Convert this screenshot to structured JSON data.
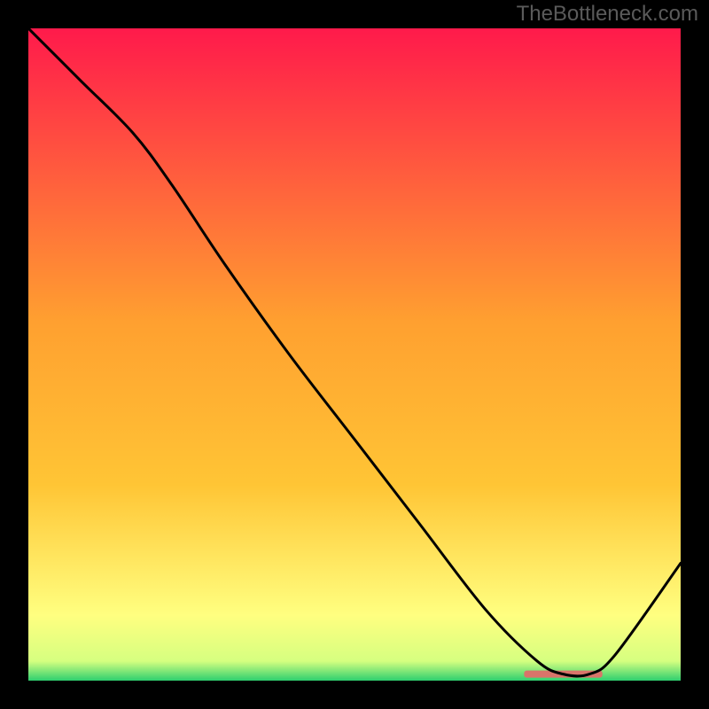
{
  "watermark": "TheBottleneck.com",
  "colors": {
    "bg": "#000000",
    "line": "#000000",
    "marker": "#d9746a",
    "watermark": "#5a5a5a",
    "gradient_top": "#ff1a4b",
    "gradient_mid": "#ffc535",
    "gradient_low": "#ffff80",
    "gradient_bottom": "#2ecf6f"
  },
  "chart_data": {
    "type": "line",
    "title": "",
    "xlabel": "",
    "ylabel": "",
    "xlim": [
      0,
      100
    ],
    "ylim": [
      0,
      100
    ],
    "x": [
      0,
      8,
      16,
      22,
      30,
      40,
      50,
      60,
      70,
      78,
      82,
      86,
      90,
      100
    ],
    "y": [
      100,
      92,
      84,
      76,
      64,
      50,
      37,
      24,
      11,
      3,
      1,
      1,
      4,
      18
    ],
    "marker_region": {
      "x_start": 76,
      "x_end": 88,
      "y": 1
    }
  }
}
